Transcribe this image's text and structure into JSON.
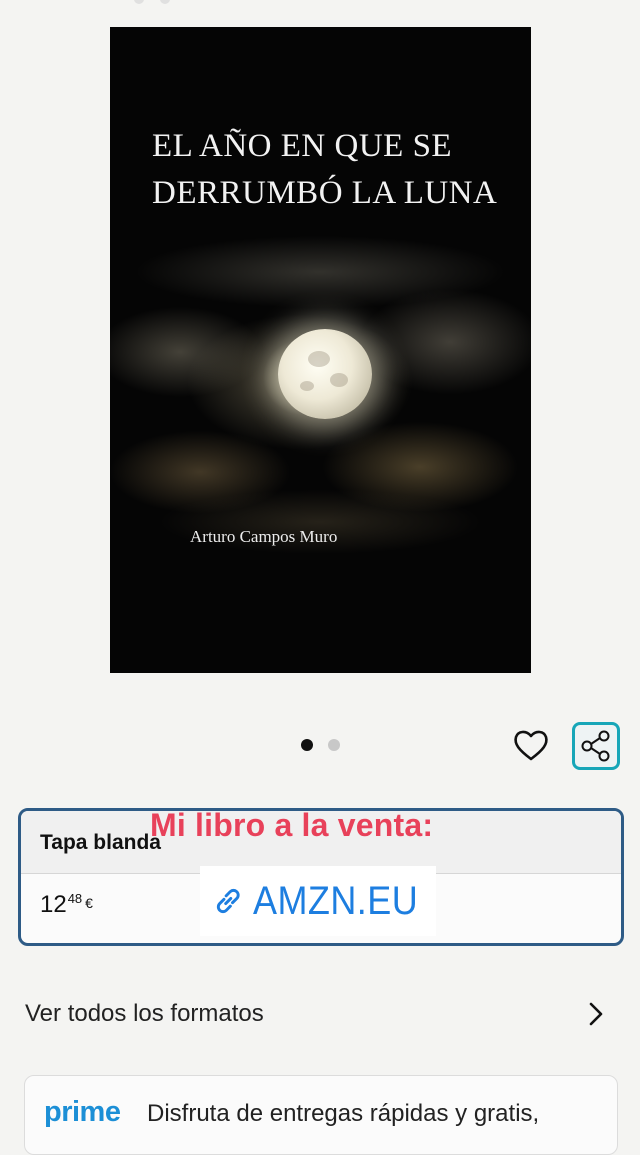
{
  "book": {
    "cover_title_line1": "EL AÑO EN QUE SE",
    "cover_title_line2": "DERRUMBÓ LA LUNA",
    "author": "Arturo Campos Muro"
  },
  "carousel": {
    "current": 1,
    "total": 2
  },
  "actions": {
    "wishlist_icon": "heart-icon",
    "share_icon": "share-icon"
  },
  "format": {
    "name": "Tapa blanda",
    "price_whole": "12",
    "price_fraction": "48",
    "currency": "€"
  },
  "overlay": {
    "headline": "Mi libro a la venta:",
    "link_icon": "link-icon",
    "link_text": "AMZN.EU",
    "color_headline": "#e8415a",
    "color_link": "#1d7ee0"
  },
  "formats_link": {
    "label": "Ver todos los formatos",
    "icon": "chevron-right-icon"
  },
  "prime": {
    "logo": "prime",
    "line1": "Disfruta de entregas rápidas y gratis,"
  },
  "colors": {
    "accent": "#17a6b8",
    "selected_border": "#2e5b86",
    "prime_blue": "#1c8fd6"
  }
}
